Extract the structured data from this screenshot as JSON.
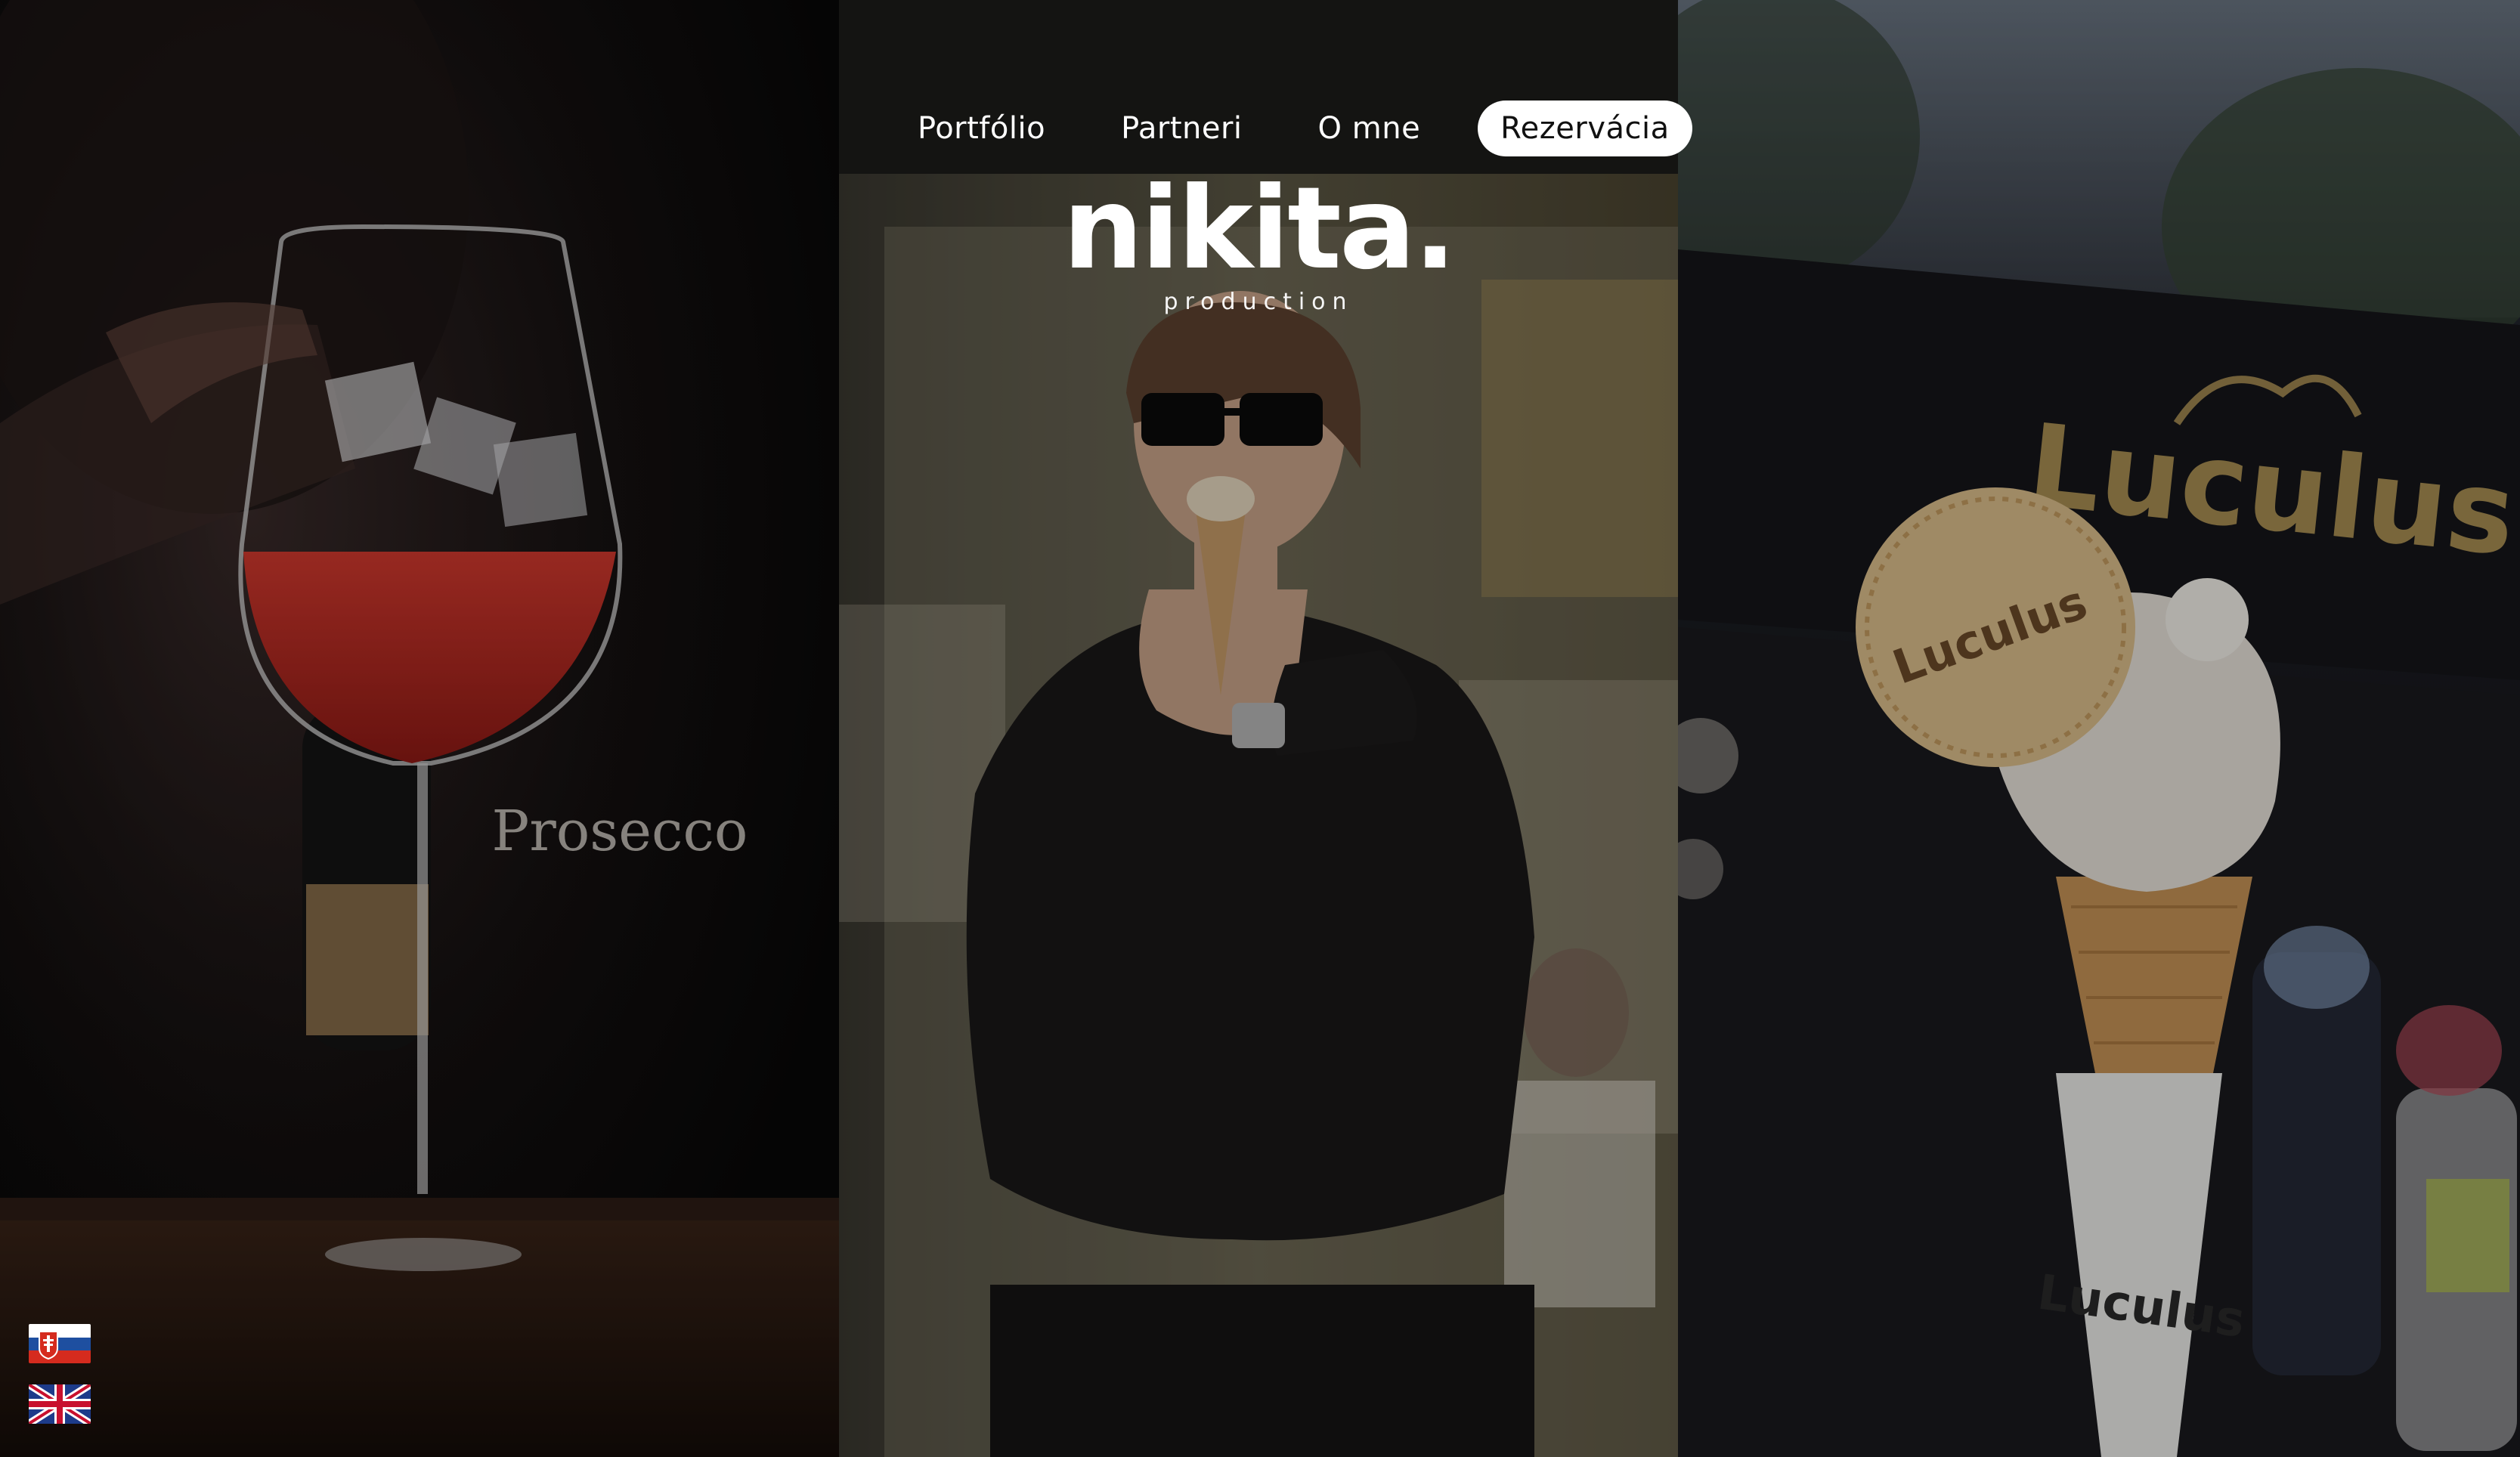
{
  "nav": {
    "items": [
      {
        "label": "Portfólio"
      },
      {
        "label": "Partneri"
      },
      {
        "label": "O mne"
      }
    ],
    "cta_label": "Rezervácia"
  },
  "logo": {
    "word": "nikita.",
    "sub": "production"
  },
  "panels": {
    "left": {
      "caption": "Prosecco",
      "label": "prosecco-cocktail-photo"
    },
    "center": {
      "label": "person-eating-ice-cream-photo"
    },
    "right": {
      "sign": "Luculus",
      "wafer": "Luculus",
      "cone": "Luculus",
      "label": "ice-cream-cone-photo"
    }
  },
  "languages": [
    {
      "code": "sk",
      "name": "slovak-flag"
    },
    {
      "code": "en",
      "name": "uk-flag"
    }
  ],
  "colors": {
    "text": "#ffffff",
    "cta_bg": "#ffffff",
    "cta_text": "#111111"
  }
}
